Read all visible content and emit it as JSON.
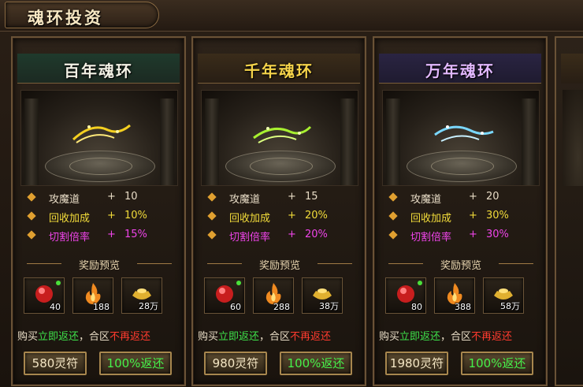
{
  "window": {
    "title": "魂环投资"
  },
  "reward_preview_label": "奖励预览",
  "cards": [
    {
      "title": "百年魂环",
      "stats": [
        {
          "name": "攻魔道",
          "plus": "+",
          "value": "10"
        },
        {
          "name": "回收加成",
          "plus": "+",
          "value": "10%"
        },
        {
          "name": "切割倍率",
          "plus": "+",
          "value": "15%"
        }
      ],
      "rewards": [
        {
          "icon": "red-orb-icon",
          "count": "40"
        },
        {
          "icon": "flame-icon",
          "count": "188"
        },
        {
          "icon": "gold-ingot-icon",
          "count": "28万"
        }
      ],
      "notice": {
        "prefix": "购买",
        "green": "立即返还",
        "mid": "，合区",
        "red": "不再返还"
      },
      "buy_label": "580灵符",
      "return_label": "100%返还"
    },
    {
      "title": "千年魂环",
      "stats": [
        {
          "name": "攻魔道",
          "plus": "+",
          "value": "15"
        },
        {
          "name": "回收加成",
          "plus": "+",
          "value": "20%"
        },
        {
          "name": "切割倍率",
          "plus": "+",
          "value": "20%"
        }
      ],
      "rewards": [
        {
          "icon": "red-orb-icon",
          "count": "60"
        },
        {
          "icon": "flame-icon",
          "count": "288"
        },
        {
          "icon": "gold-ingot-icon",
          "count": "38万"
        }
      ],
      "notice": {
        "prefix": "购买",
        "green": "立即返还",
        "mid": "，合区",
        "red": "不再返还"
      },
      "buy_label": "980灵符",
      "return_label": "100%返还"
    },
    {
      "title": "万年魂环",
      "stats": [
        {
          "name": "攻魔道",
          "plus": "+",
          "value": "20"
        },
        {
          "name": "回收加成",
          "plus": "+",
          "value": "30%"
        },
        {
          "name": "切割倍率",
          "plus": "+",
          "value": "30%"
        }
      ],
      "rewards": [
        {
          "icon": "red-orb-icon",
          "count": "80"
        },
        {
          "icon": "flame-icon",
          "count": "388"
        },
        {
          "icon": "gold-ingot-icon",
          "count": "58万"
        }
      ],
      "notice": {
        "prefix": "购买",
        "green": "立即返还",
        "mid": "，合区",
        "red": "不再返还"
      },
      "buy_label": "1980灵符",
      "return_label": "100%返还"
    }
  ],
  "colors": {
    "ring_100": "#f5d020",
    "ring_1000": "#a8f030",
    "ring_10000": "#7ad8ff",
    "stat_white": "#e8dcc6",
    "stat_yellow": "#f2dc3a",
    "stat_magenta": "#f044ea",
    "notice_green": "#3ee04a",
    "notice_red": "#ff3b2e"
  }
}
